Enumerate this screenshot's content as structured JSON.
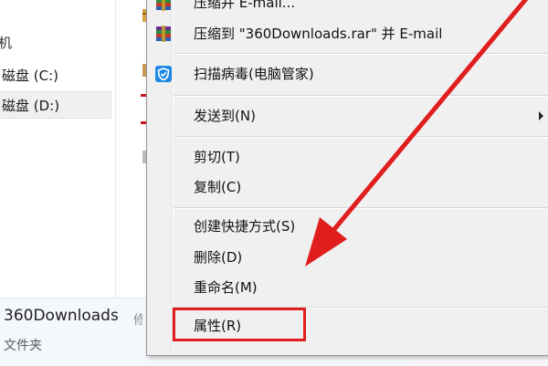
{
  "nav": {
    "partial_label": "机",
    "drives": [
      {
        "label": "磁盘 (C:)"
      },
      {
        "label": "磁盘 (D:)"
      }
    ]
  },
  "details": {
    "name": "360Downloads",
    "type": "文件夹",
    "clipped_text": "修"
  },
  "context_menu": {
    "items": [
      {
        "label": "压缩并 E-mail...",
        "icon": "winrar-archive-icon"
      },
      {
        "label": "压缩到 \"360Downloads.rar\" 并 E-mail",
        "icon": "winrar-archive-icon"
      },
      {
        "label": "扫描病毒(电脑管家)",
        "icon": "tencent-shield-icon"
      },
      {
        "label": "发送到(N)",
        "has_submenu": true
      },
      {
        "label": "剪切(T)"
      },
      {
        "label": "复制(C)"
      },
      {
        "label": "创建快捷方式(S)"
      },
      {
        "label": "删除(D)"
      },
      {
        "label": "重命名(M)"
      },
      {
        "label": "属性(R)"
      }
    ]
  },
  "annotation": {
    "highlight_color": "#e01e1e",
    "highlighted_item": "属性(R)"
  },
  "colors": {
    "menu_background": "#f0f0f0",
    "details_background": "#f4f7fb",
    "accent_red": "#e01e1e"
  }
}
